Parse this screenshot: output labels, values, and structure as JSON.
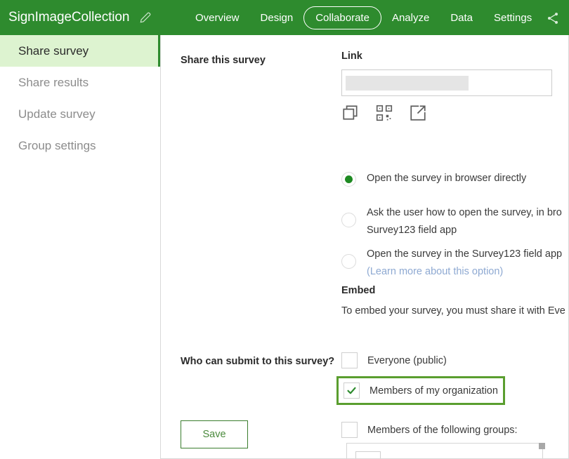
{
  "header": {
    "survey_title": "SignImageCollection",
    "edit_icon": "pencil-icon",
    "share_icon": "share-icon",
    "nav": [
      {
        "label": "Overview",
        "active": false
      },
      {
        "label": "Design",
        "active": false
      },
      {
        "label": "Collaborate",
        "active": true
      },
      {
        "label": "Analyze",
        "active": false
      },
      {
        "label": "Data",
        "active": false
      },
      {
        "label": "Settings",
        "active": false
      }
    ]
  },
  "sidebar": {
    "items": [
      {
        "label": "Share survey",
        "active": true
      },
      {
        "label": "Share results",
        "active": false
      },
      {
        "label": "Update survey",
        "active": false
      },
      {
        "label": "Group settings",
        "active": false
      }
    ]
  },
  "main": {
    "share_section_label": "Share this survey",
    "link": {
      "title": "Link",
      "value": "",
      "redacted": true,
      "icons": [
        {
          "name": "copy-icon"
        },
        {
          "name": "qr-code-icon"
        },
        {
          "name": "open-external-icon"
        }
      ]
    },
    "open_options": [
      {
        "label": "Open the survey in browser directly",
        "checked": true,
        "sublabel": ""
      },
      {
        "label": " Ask the user how to open the survey, in bro",
        "line2": "Survey123 field app",
        "checked": false
      },
      {
        "label": "Open the survey in the Survey123 field app",
        "sublabel": "(Learn more about this option)",
        "checked": false
      }
    ],
    "embed": {
      "title": "Embed",
      "text": "To embed your survey, you must share it with Eve"
    },
    "submit_section_label": "Who can submit to this survey?",
    "submit_options": [
      {
        "label": "Everyone (public)",
        "checked": false,
        "highlighted": false
      },
      {
        "label": "Members of my organization",
        "checked": true,
        "highlighted": true
      },
      {
        "label": "Members of the following groups:",
        "checked": false,
        "highlighted": false
      }
    ],
    "save_label": "Save"
  },
  "colors": {
    "header_green": "#2e8b2e",
    "sidebar_active_bg": "#ddf3d0",
    "accent_green": "#1e8a22",
    "highlight_border": "#5a9e2f",
    "save_border": "#3b7d2e"
  }
}
